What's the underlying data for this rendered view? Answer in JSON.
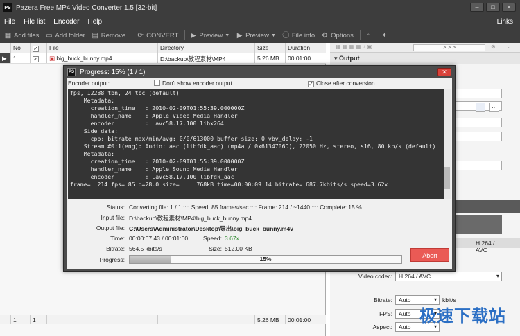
{
  "window": {
    "title": "Pazera Free MP4 Video Converter 1.5  [32-bit]",
    "logo": "PS"
  },
  "menu": {
    "items": [
      "File",
      "File list",
      "Encoder",
      "Help"
    ],
    "right": "Links"
  },
  "toolbar": {
    "add_files": "Add files",
    "add_folder": "Add folder",
    "remove": "Remove",
    "convert": "CONVERT",
    "preview1": "Preview",
    "preview2": "Preview",
    "file_info": "File info",
    "options": "Options"
  },
  "grid": {
    "headers": {
      "no": "No",
      "file": "File",
      "directory": "Directory",
      "size": "Size",
      "duration": "Duration"
    },
    "row": {
      "no": "1",
      "file": "big_buck_bunny.mp4",
      "directory": "D:\\backup\\教程素材\\MP4",
      "size": "5.26 MB",
      "duration": "00:01:00"
    },
    "footer": {
      "count1": "1",
      "count2": "1",
      "size": "5.26 MB",
      "duration": "00:01:00"
    }
  },
  "right_panel": {
    "nav": "> > >",
    "output": "Output",
    "codec_display": "H.264 / AVC",
    "video_codec_label": "Video codec:",
    "video_codec_value": "H.264 / AVC",
    "bitrate_label": "Bitrate:",
    "bitrate_value": "Auto",
    "bitrate_unit": "kbit/s",
    "fps_label": "FPS:",
    "fps_value": "Auto",
    "aspect_label": "Aspect:",
    "aspect_value": "Auto"
  },
  "watermark": "极速下载站",
  "dialog": {
    "title": "Progress: 15% (1 / 1)",
    "encoder_output": "Encoder output:",
    "dont_show": "Don't show encoder output",
    "close_after": "Close after conversion",
    "console": "fps, 12288 tbn, 24 tbc (default)\n    Metadata:\n      creation_time   : 2010-02-09T01:55:39.000000Z\n      handler_name    : Apple Video Media Handler\n      encoder         : Lavc58.17.100 libx264\n    Side data:\n      cpb: bitrate max/min/avg: 0/0/613000 buffer size: 0 vbv_delay: -1\n    Stream #0:1(eng): Audio: aac (libfdk_aac) (mp4a / 0x6134706D), 22050 Hz, stereo, s16, 80 kb/s (default)\n    Metadata:\n      creation_time   : 2010-02-09T01:55:39.000000Z\n      handler_name    : Apple Sound Media Handler\n      encoder         : Lavc58.17.100 libfdk_aac\nframe=  214 fps= 85 q=28.0 size=     768kB time=00:00:09.14 bitrate= 687.7kbits/s speed=3.62x",
    "status_label": "Status:",
    "status_value": "Converting file: 1 / 1  ::::  Speed: 85 frames/sec  ::::  Frame: 214 / ~1440  ::::  Complete: 15 %",
    "input_label": "Input file:",
    "input_value": "D:\\backup\\教程素材\\MP4\\big_buck_bunny.mp4",
    "output_label": "Output file:",
    "output_value": "C:\\Users\\Administrator\\Desktop\\导出\\big_buck_bunny.m4v",
    "time_label": "Time:",
    "time_value": "00:00:07.43 / 00:01:00",
    "speed_label": "Speed:",
    "speed_value": "3.67x",
    "bitrate_label": "Bitrate:",
    "bitrate_value": "564.5 kbits/s",
    "size_label": "Size:",
    "size_value": "512.00 KB",
    "progress_label": "Progress:",
    "progress_text": "15%",
    "progress_fraction": 0.15,
    "abort": "Abort"
  }
}
